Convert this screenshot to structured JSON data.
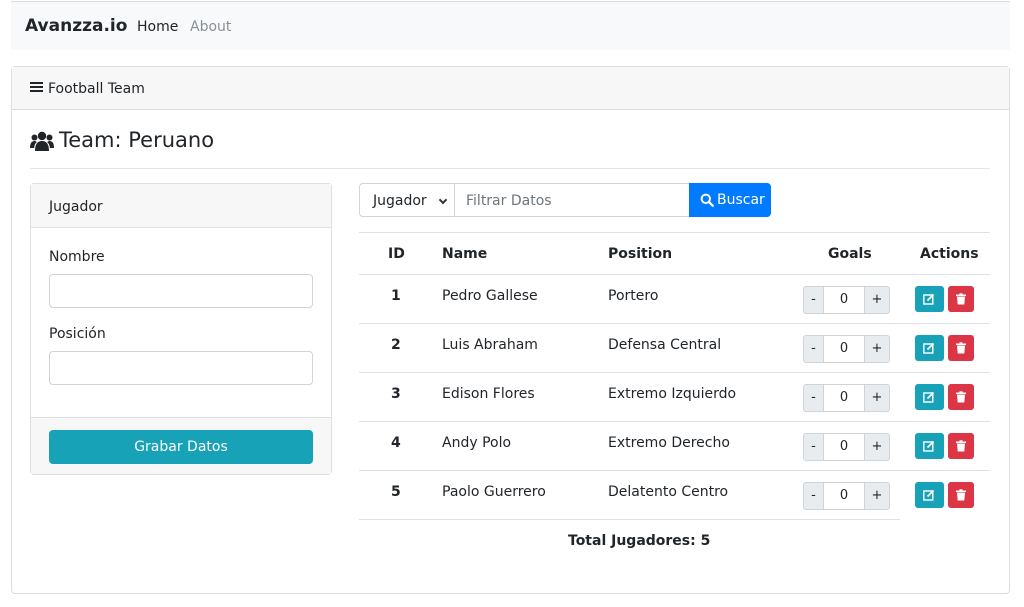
{
  "navbar": {
    "brand": "Avanzza.io",
    "links": [
      {
        "label": "Home"
      },
      {
        "label": "About"
      }
    ]
  },
  "card": {
    "header_title": "Football Team",
    "header_icon": "list-icon"
  },
  "team": {
    "title": "Team: Peruano",
    "icon": "users-icon"
  },
  "form": {
    "header": "Jugador",
    "name_label": "Nombre",
    "name_value": "",
    "position_label": "Posición",
    "position_value": "",
    "save_label": "Grabar Datos"
  },
  "filter": {
    "select_value": "Jugador",
    "input_placeholder": "Filtrar Datos",
    "search_label": "Buscar",
    "search_icon": "search-icon"
  },
  "table": {
    "columns": [
      "ID",
      "Name",
      "Position",
      "Goals",
      "Actions"
    ],
    "rows": [
      {
        "id": "1",
        "name": "Pedro Gallese",
        "position": "Portero",
        "goals": "0"
      },
      {
        "id": "2",
        "name": "Luis Abraham",
        "position": "Defensa Central",
        "goals": "0"
      },
      {
        "id": "3",
        "name": "Edison Flores",
        "position": "Extremo Izquierdo",
        "goals": "0"
      },
      {
        "id": "4",
        "name": "Andy Polo",
        "position": "Extremo Derecho",
        "goals": "0"
      },
      {
        "id": "5",
        "name": "Paolo Guerrero",
        "position": "Delatento Centro",
        "goals": "0"
      }
    ],
    "minus": "-",
    "plus": "+",
    "total": "Total Jugadores: 5"
  },
  "colors": {
    "primary": "#007bff",
    "info": "#17a2b8",
    "danger": "#dc3545"
  }
}
